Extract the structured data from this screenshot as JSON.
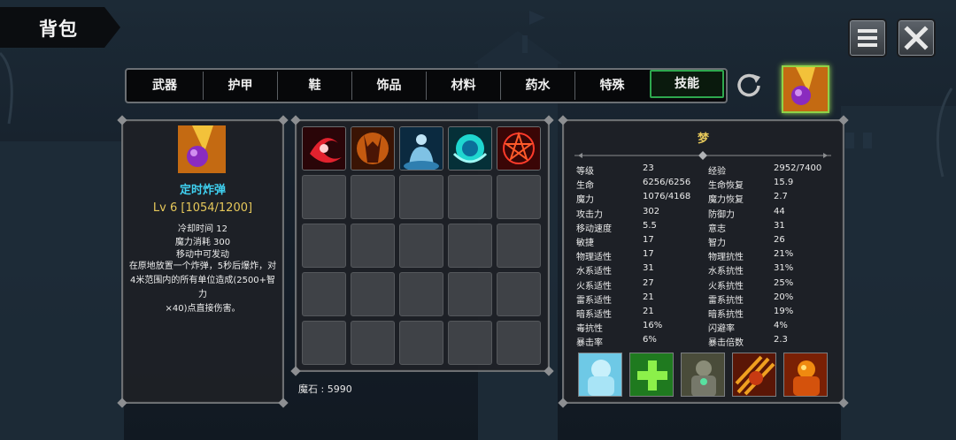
{
  "window": {
    "title": "背包"
  },
  "tabs": [
    {
      "label": "武器",
      "active": false
    },
    {
      "label": "护甲",
      "active": false
    },
    {
      "label": "鞋",
      "active": false
    },
    {
      "label": "饰品",
      "active": false
    },
    {
      "label": "材料",
      "active": false
    },
    {
      "label": "药水",
      "active": false
    },
    {
      "label": "特殊",
      "active": false
    },
    {
      "label": "技能",
      "active": true
    }
  ],
  "icons": {
    "menu": "menu-icon",
    "close": "close-icon",
    "refresh": "refresh-icon",
    "equipped": "bomb-icon"
  },
  "skill": {
    "name": "定时炸弹",
    "level_line": "Lv 6 [1054/1200]",
    "cooldown": "冷却时间 12",
    "mana_cost": "魔力消耗 300",
    "castable": "移动中可发动",
    "desc_line1": "在原地放置一个炸弹，5秒后爆炸，对",
    "desc_line2": "4米范围内的所有单位造成(2500+智力",
    "desc_line3": "×40)点直接伤害。"
  },
  "skill_grid": {
    "filled": [
      "swirl-icon",
      "demon-icon",
      "aura-icon",
      "orb-icon",
      "pentagram-icon"
    ],
    "empty_slots": 20
  },
  "currency": {
    "label": "魔石 : 5990"
  },
  "stats": {
    "character_name": "梦",
    "rows": [
      {
        "k1": "等级",
        "v1": "23",
        "k2": "经验",
        "v2": "2952/7400"
      },
      {
        "k1": "生命",
        "v1": "6256/6256",
        "k2": "生命恢复",
        "v2": "15.9"
      },
      {
        "k1": "魔力",
        "v1": "1076/4168",
        "k2": "魔力恢复",
        "v2": "2.7"
      },
      {
        "k1": "攻击力",
        "v1": "302",
        "k2": "防御力",
        "v2": "44"
      },
      {
        "k1": "移动速度",
        "v1": "5.5",
        "k2": "意志",
        "v2": "31"
      },
      {
        "k1": "敏捷",
        "v1": "17",
        "k2": "智力",
        "v2": "26"
      },
      {
        "k1": "物理适性",
        "v1": "17",
        "k2": "物理抗性",
        "v2": "21%"
      },
      {
        "k1": "水系适性",
        "v1": "31",
        "k2": "水系抗性",
        "v2": "31%"
      },
      {
        "k1": "火系适性",
        "v1": "27",
        "k2": "火系抗性",
        "v2": "25%"
      },
      {
        "k1": "雷系适性",
        "v1": "21",
        "k2": "雷系抗性",
        "v2": "20%"
      },
      {
        "k1": "暗系适性",
        "v1": "21",
        "k2": "暗系抗性",
        "v2": "19%"
      },
      {
        "k1": "毒抗性",
        "v1": "16%",
        "k2": "闪避率",
        "v2": "4%"
      },
      {
        "k1": "暴击率",
        "v1": "6%",
        "k2": "暴击倍数",
        "v2": "2.3"
      }
    ],
    "passives": [
      "ice-golem-icon",
      "heal-cross-icon",
      "stone-golem-icon",
      "claw-slash-icon",
      "fire-golem-icon"
    ]
  },
  "colors": {
    "active_tab": "#2ea84e",
    "skill_name": "#3fd0f0",
    "level": "#e6c85a"
  }
}
